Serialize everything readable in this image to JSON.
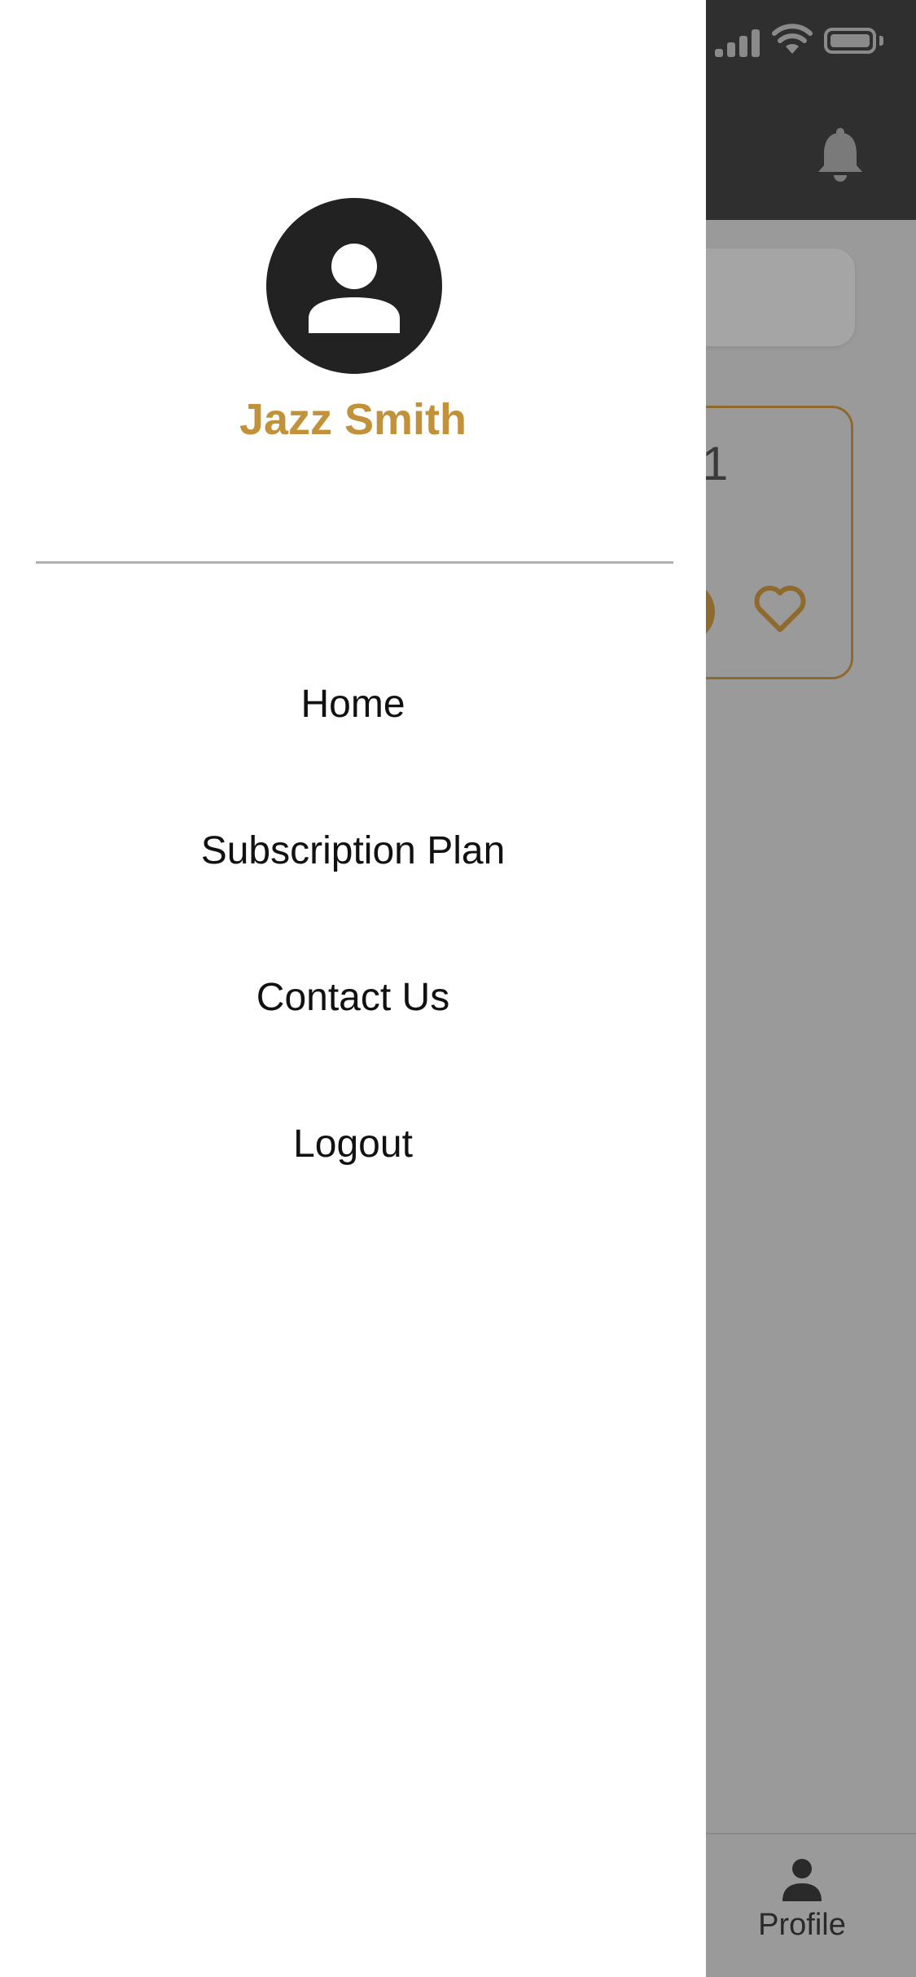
{
  "drawer": {
    "user_name": "Jazz Smith",
    "menu": [
      {
        "label": "Home"
      },
      {
        "label": "Subscription Plan"
      },
      {
        "label": "Contact Us"
      },
      {
        "label": "Logout"
      }
    ]
  },
  "background": {
    "card_partial_number": "1",
    "tabbar": {
      "profile_label": "Profile"
    }
  },
  "icons": {
    "avatar": "user-avatar-icon",
    "notifications": "bell-icon",
    "favorite": "heart-icon",
    "profile_tab": "person-icon"
  },
  "colors": {
    "accent": "#c2923a",
    "header": "#2f2f2f",
    "overlay": "#9a9a9a",
    "drawer": "#ffffff"
  }
}
